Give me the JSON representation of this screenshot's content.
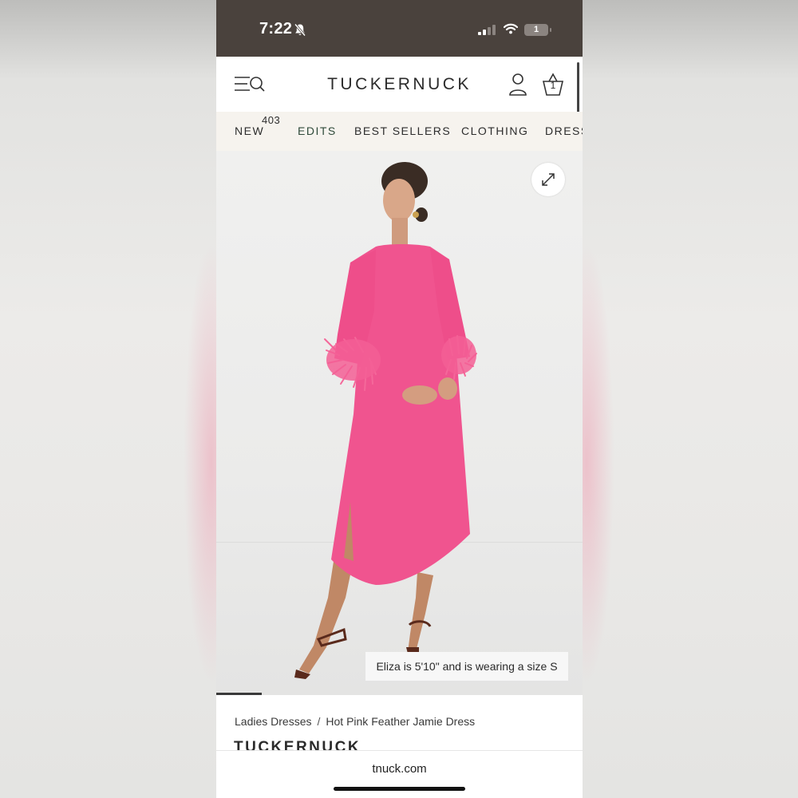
{
  "status_bar": {
    "time": "7:22",
    "battery_level": "1",
    "icons": [
      "bell-off-icon",
      "signal-icon",
      "wifi-icon",
      "battery-icon"
    ]
  },
  "header": {
    "brand": "TUCKERNUCK",
    "bag_count": "1",
    "icons": [
      "menu-search-icon",
      "account-icon",
      "bag-icon"
    ]
  },
  "nav": {
    "items": [
      {
        "label": "NEW",
        "badge": "403"
      },
      {
        "label": "EDITS"
      },
      {
        "label": "BEST SELLERS"
      },
      {
        "label": "CLOTHING"
      },
      {
        "label": "DRESSES"
      }
    ]
  },
  "product": {
    "caption": "Eliza is 5'10\" and is wearing a size S",
    "dress_color": "#f0548f",
    "breadcrumb": [
      "Ladies Dresses",
      "Hot Pink Feather Jamie Dress"
    ],
    "breadcrumb_separator": "/",
    "brand_heading": "TUCKERNUCK"
  },
  "browser": {
    "url": "tnuck.com"
  },
  "colors": {
    "status_bar_bg": "#4a423d",
    "nav_bg": "#f6f3ee",
    "edits_accent": "#2f4a3a"
  }
}
